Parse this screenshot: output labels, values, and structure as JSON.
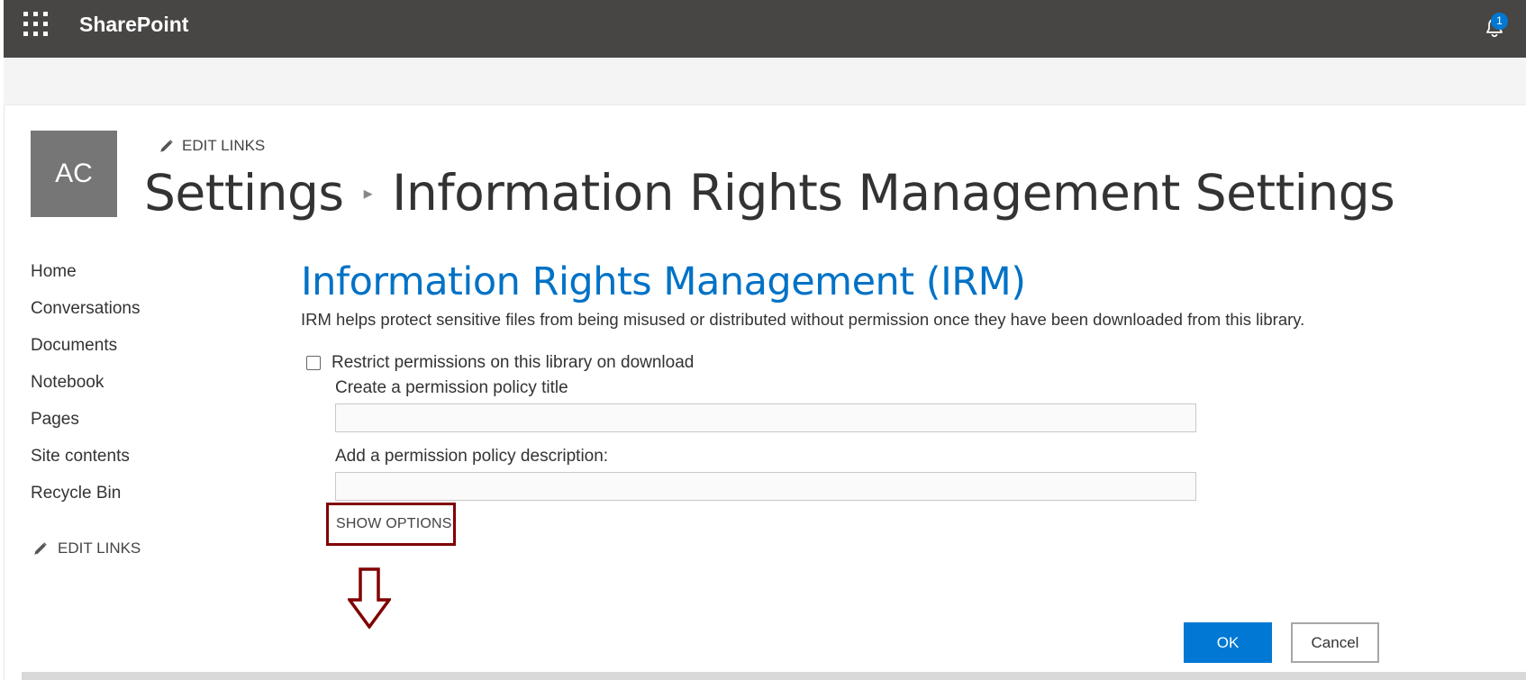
{
  "suite_bar": {
    "app_name": "SharePoint",
    "notification_count": "1",
    "icons": [
      "app-launcher-icon",
      "bell-icon"
    ]
  },
  "site": {
    "logo_text": "AC",
    "edit_links_label": "EDIT LINKS"
  },
  "breadcrumb": {
    "parent": "Settings",
    "current": "Information Rights Management Settings"
  },
  "left_nav": {
    "items": [
      {
        "label": "Home"
      },
      {
        "label": "Conversations"
      },
      {
        "label": "Documents"
      },
      {
        "label": "Notebook"
      },
      {
        "label": "Pages"
      },
      {
        "label": "Site contents"
      },
      {
        "label": "Recycle Bin"
      }
    ],
    "edit_links_label": "EDIT LINKS"
  },
  "irm": {
    "title": "Information Rights Management (IRM)",
    "description": "IRM helps protect sensitive files from being misused or distributed without permission once they have been downloaded from this library.",
    "restrict_label": "Restrict permissions on this library on download",
    "restrict_checked": false,
    "policy_title_label": "Create a permission policy title",
    "policy_title_value": "",
    "policy_description_label": "Add a permission policy description:",
    "policy_description_value": "",
    "show_options_label": "SHOW OPTIONS"
  },
  "actions": {
    "ok_label": "OK",
    "cancel_label": "Cancel"
  },
  "colors": {
    "suite_bar": "#484644",
    "accent": "#0078d4",
    "title_blue": "#0072c6",
    "highlight_box": "#800000"
  }
}
